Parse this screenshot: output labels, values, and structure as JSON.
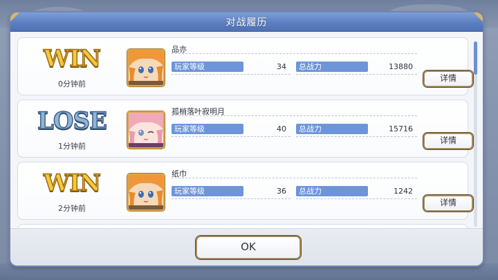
{
  "dialog": {
    "title": "对战履历",
    "ok_label": "OK"
  },
  "entries": [
    {
      "result": "WIN",
      "time_ago": "0分钟前",
      "player_name": "品亦",
      "level_label": "玩家等级",
      "level": "34",
      "power_label": "总战力",
      "power": "13880",
      "detail_label": "详情"
    },
    {
      "result": "LOSE",
      "time_ago": "1分钟前",
      "player_name": "孤梢落叶寂明月",
      "level_label": "玩家等级",
      "level": "40",
      "power_label": "总战力",
      "power": "15716",
      "detail_label": "详情"
    },
    {
      "result": "WIN",
      "time_ago": "2分钟前",
      "player_name": "纸巾",
      "level_label": "玩家等级",
      "level": "36",
      "power_label": "总战力",
      "power": "1242",
      "detail_label": "详情"
    }
  ],
  "colors": {
    "header_blue": "#5d7fc2",
    "stat_label_blue": "#6d95d8",
    "win_gold": "#f5c93b",
    "lose_blue": "#8fb4d9"
  },
  "icons": {
    "avatar_1": "orange-hair-character-portrait",
    "avatar_2": "pink-hair-character-portrait",
    "avatar_3": "orange-hair-character-portrait"
  }
}
